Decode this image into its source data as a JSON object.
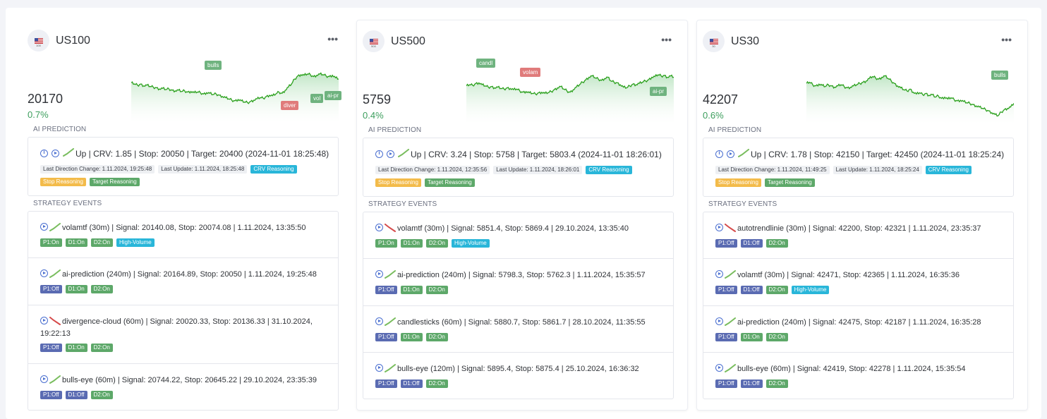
{
  "colors": {
    "green": "#3c9e5d",
    "line": "#2a9d1e",
    "red": "#e07b7b",
    "blue": "#4a6fd0"
  },
  "labels": {
    "ai_prediction": "AI PREDICTION",
    "strategy_events": "STRATEGY EVENTS",
    "more": "•••"
  },
  "cards": [
    {
      "symbol": "US100",
      "flag_sub": "100",
      "price": "20170",
      "change": "0.7%",
      "chart_tags": [
        "bulls",
        "diver",
        "vol",
        "ai-pr"
      ],
      "prediction": {
        "direction": "up",
        "text": "Up | CRV: 1.85 | Stop: 20050 | Target: 20400 (2024-11-01 18:25:48)",
        "last_change": "Last Direction Change: 1.11.2024, 19:25:48",
        "last_update": "Last Update: 1.11.2024, 18:25:48",
        "crv": "CRV Reasoning",
        "stop": "Stop Reasoning",
        "target": "Target Reasoning"
      },
      "events": [
        {
          "trend": "up",
          "text": "volamtf (30m) | Signal: 20140.08, Stop: 20074.08 | 1.11.2024, 13:35:50",
          "tags": [
            "P1:On",
            "D1:On",
            "D2:On",
            "High-Volume"
          ]
        },
        {
          "trend": "up",
          "text": "ai-prediction (240m) | Signal: 20164.89, Stop: 20050 | 1.11.2024, 19:25:48",
          "tags": [
            "P1:Off",
            "D1:On",
            "D2:On"
          ]
        },
        {
          "trend": "down",
          "text": "divergence-cloud (60m) | Signal: 20020.33, Stop: 20136.33 | 31.10.2024, 19:22:13",
          "tags": [
            "P1:Off",
            "D1:On",
            "D2:On"
          ]
        },
        {
          "trend": "up",
          "text": "bulls-eye (60m) | Signal: 20744.22, Stop: 20645.22 | 29.10.2024, 23:35:39",
          "tags": [
            "P1:Off",
            "D1:Off",
            "D2:On"
          ]
        }
      ]
    },
    {
      "symbol": "US500",
      "flag_sub": "500",
      "price": "5759",
      "change": "0.4%",
      "chart_tags": [
        "candl",
        "volam",
        "ai-pr"
      ],
      "prediction": {
        "direction": "up",
        "text": "Up | CRV: 3.24 | Stop: 5758 | Target: 5803.4 (2024-11-01 18:26:01)",
        "last_change": "Last Direction Change: 1.11.2024, 12:35:56",
        "last_update": "Last Update: 1.11.2024, 18:26:01",
        "crv": "CRV Reasoning",
        "stop": "Stop Reasoning",
        "target": "Target Reasoning"
      },
      "events": [
        {
          "trend": "down",
          "text": "volamtf (30m) | Signal: 5851.4, Stop: 5869.4 | 29.10.2024, 13:35:40",
          "tags": [
            "P1:On",
            "D1:On",
            "D2:On",
            "High-Volume"
          ]
        },
        {
          "trend": "up",
          "text": "ai-prediction (240m) | Signal: 5798.3, Stop: 5762.3 | 1.11.2024, 15:35:57",
          "tags": [
            "P1:Off",
            "D1:On",
            "D2:On"
          ]
        },
        {
          "trend": "up",
          "text": "candlesticks (60m) | Signal: 5880.7, Stop: 5861.7 | 28.10.2024, 11:35:55",
          "tags": [
            "P1:Off",
            "D1:On",
            "D2:On"
          ]
        },
        {
          "trend": "up",
          "text": "bulls-eye (120m) | Signal: 5895.4, Stop: 5875.4 | 25.10.2024, 16:36:32",
          "tags": [
            "P1:Off",
            "D1:Off",
            "D2:On"
          ]
        }
      ]
    },
    {
      "symbol": "US30",
      "flag_sub": "30",
      "price": "42207",
      "change": "0.6%",
      "chart_tags": [
        "bulls"
      ],
      "prediction": {
        "direction": "up",
        "text": "Up | CRV: 1.78 | Stop: 42150 | Target: 42450 (2024-11-01 18:25:24)",
        "last_change": "Last Direction Change: 1.11.2024, 11:49:25",
        "last_update": "Last Update: 1.11.2024, 18:25:24",
        "crv": "CRV Reasoning",
        "stop": "Stop Reasoning",
        "target": "Target Reasoning"
      },
      "events": [
        {
          "trend": "down",
          "text": "autotrendlinie (30m) | Signal: 42200, Stop: 42321 | 1.11.2024, 23:35:37",
          "tags": [
            "P1:Off",
            "D1:Off",
            "D2:On"
          ]
        },
        {
          "trend": "up",
          "text": "volamtf (30m) | Signal: 42471, Stop: 42365 | 1.11.2024, 16:35:36",
          "tags": [
            "P1:Off",
            "D1:Off",
            "D2:On",
            "High-Volume"
          ]
        },
        {
          "trend": "up",
          "text": "ai-prediction (240m) | Signal: 42475, Stop: 42187 | 1.11.2024, 16:35:28",
          "tags": [
            "P1:Off",
            "D1:On",
            "D2:On"
          ]
        },
        {
          "trend": "up",
          "text": "bulls-eye (60m) | Signal: 42419, Stop: 42278 | 1.11.2024, 15:35:54",
          "tags": [
            "P1:Off",
            "D1:Off",
            "D2:On"
          ]
        }
      ]
    }
  ]
}
